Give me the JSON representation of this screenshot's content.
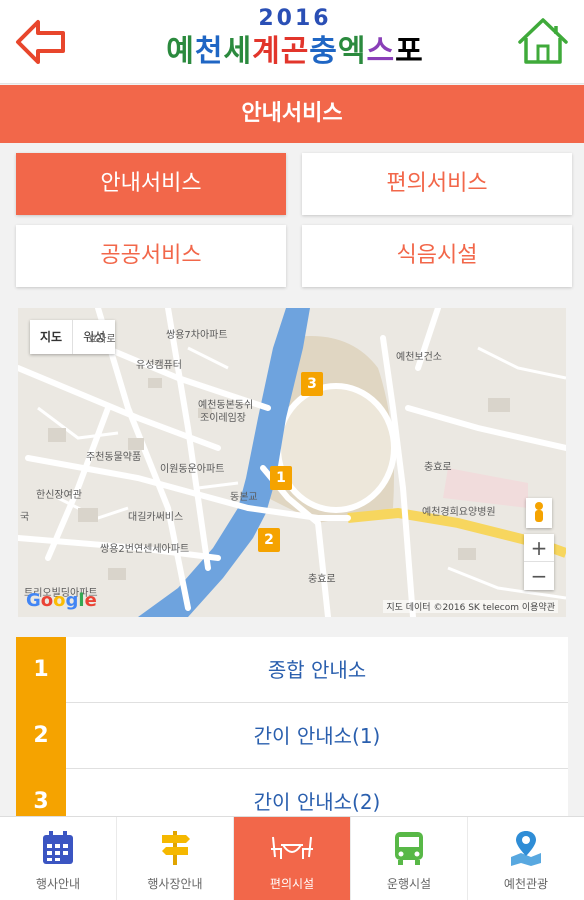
{
  "header": {
    "logo_year": "2016",
    "logo_title": [
      "예",
      "천",
      "세",
      "계",
      "곤",
      "충",
      "엑",
      "스",
      "포"
    ],
    "back_icon": "arrow-left-icon",
    "home_icon": "home-icon"
  },
  "title_bar": {
    "title": "안내서비스"
  },
  "categories": [
    {
      "label": "안내서비스",
      "active": true
    },
    {
      "label": "편의서비스",
      "active": false
    },
    {
      "label": "공공서비스",
      "active": false
    },
    {
      "label": "식음시설",
      "active": false
    }
  ],
  "map": {
    "type_buttons": [
      "지도",
      "위성"
    ],
    "markers": [
      "1",
      "2",
      "3"
    ],
    "labels": [
      "쌍용7차아파트",
      "유성캠퓨터",
      "예천동본동쉬",
      "조이레임장",
      "주천동물약품",
      "이원동운아파트",
      "한신장여관",
      "대길카써비스",
      "쌍용2번연센세아파트",
      "동본교",
      "예천보건소",
      "충효로",
      "예천경희요양병원",
      "충효로",
      "효자로",
      "국",
      "트리오빌딩아파트"
    ],
    "zoom_in": "+",
    "zoom_out": "−",
    "google": [
      "G",
      "o",
      "o",
      "g",
      "l",
      "e"
    ],
    "credit": "지도 데이터 ©2016 SK telecom    이용약관"
  },
  "list": [
    {
      "num": "1",
      "label": "종합 안내소"
    },
    {
      "num": "2",
      "label": "간이 안내소(1)"
    },
    {
      "num": "3",
      "label": "간이 안내소(2)"
    }
  ],
  "bottom_nav": [
    {
      "label": "행사안내",
      "icon": "calendar-icon",
      "active": false
    },
    {
      "label": "행사장안내",
      "icon": "signpost-icon",
      "active": false
    },
    {
      "label": "편의시설",
      "icon": "table-icon",
      "active": true
    },
    {
      "label": "운행시설",
      "icon": "bus-icon",
      "active": false
    },
    {
      "label": "예천관광",
      "icon": "map-pin-icon",
      "active": false
    }
  ],
  "colors": {
    "accent": "#f2674a",
    "marker": "#f5a300",
    "list_text": "#2a5fae"
  }
}
